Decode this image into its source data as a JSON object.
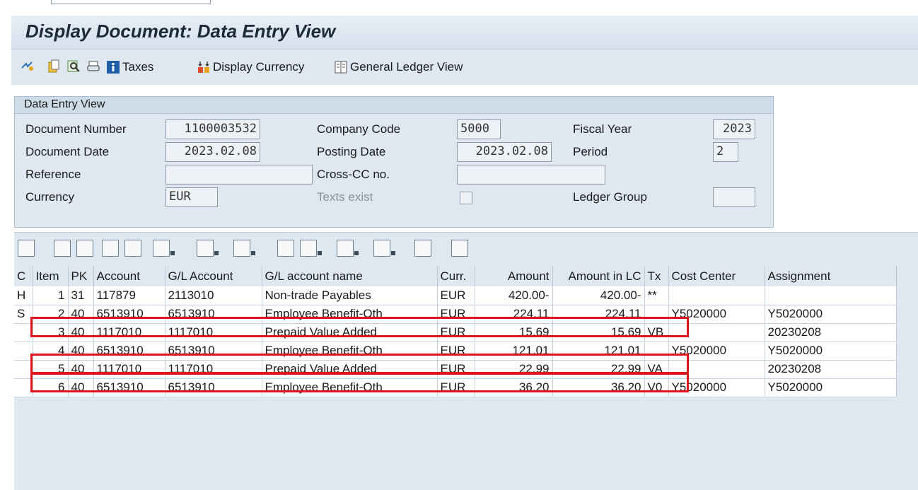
{
  "title": "Display Document: Data Entry View",
  "toolbar": {
    "icons": [
      "display-other-icon",
      "document-icon",
      "search-icon",
      "print-icon",
      "info-icon"
    ],
    "taxes_label": "Taxes",
    "display_currency_label": "Display Currency",
    "general_ledger_view_label": "General Ledger View"
  },
  "group": {
    "title": "Data Entry View",
    "document_number_label": "Document Number",
    "document_number": "1100003532",
    "company_code_label": "Company Code",
    "company_code": "5000",
    "fiscal_year_label": "Fiscal Year",
    "fiscal_year": "2023",
    "document_date_label": "Document Date",
    "document_date": "2023.02.08",
    "posting_date_label": "Posting Date",
    "posting_date": "2023.02.08",
    "period_label": "Period",
    "period": "2",
    "reference_label": "Reference",
    "reference": "",
    "cross_cc_label": "Cross-CC no.",
    "cross_cc": "",
    "currency_label": "Currency",
    "currency": "EUR",
    "texts_exist_label": "Texts exist",
    "ledger_group_label": "Ledger Group",
    "ledger_group": ""
  },
  "grid": {
    "columns": [
      "C",
      "Item",
      "PK",
      "Account",
      "G/L Account",
      "G/L account name",
      "Curr.",
      "Amount",
      "Amount in LC",
      "Tx",
      "Cost Center",
      "Assignment"
    ],
    "rows": [
      {
        "c": "H",
        "item": "1",
        "pk": "31",
        "account": "117879",
        "gl": "2113010",
        "name": "Non-trade Payables",
        "curr": "EUR",
        "amount": "420.00-",
        "amount_lc": "420.00-",
        "tx": "**",
        "cost_center": "",
        "assignment": ""
      },
      {
        "c": "S",
        "item": "2",
        "pk": "40",
        "account": "6513910",
        "gl": "6513910",
        "name": "Employee Benefit-Oth",
        "curr": "EUR",
        "amount": "224.11",
        "amount_lc": "224.11",
        "tx": "",
        "cost_center": "Y5020000",
        "assignment": "Y5020000"
      },
      {
        "c": "",
        "item": "3",
        "pk": "40",
        "account": "1117010",
        "gl": "1117010",
        "name": "Prepaid Value Added",
        "curr": "EUR",
        "amount": "15.69",
        "amount_lc": "15.69",
        "tx": "VB",
        "cost_center": "",
        "assignment": "20230208"
      },
      {
        "c": "",
        "item": "4",
        "pk": "40",
        "account": "6513910",
        "gl": "6513910",
        "name": "Employee Benefit-Oth",
        "curr": "EUR",
        "amount": "121.01",
        "amount_lc": "121.01",
        "tx": "",
        "cost_center": "Y5020000",
        "assignment": "Y5020000"
      },
      {
        "c": "",
        "item": "5",
        "pk": "40",
        "account": "1117010",
        "gl": "1117010",
        "name": "Prepaid Value Added",
        "curr": "EUR",
        "amount": "22.99",
        "amount_lc": "22.99",
        "tx": "VA",
        "cost_center": "",
        "assignment": "20230208"
      },
      {
        "c": "",
        "item": "6",
        "pk": "40",
        "account": "6513910",
        "gl": "6513910",
        "name": "Employee Benefit-Oth",
        "curr": "EUR",
        "amount": "36.20",
        "amount_lc": "36.20",
        "tx": "V0",
        "cost_center": "Y5020000",
        "assignment": "Y5020000"
      }
    ],
    "highlighted_items": [
      "3",
      "5",
      "6"
    ],
    "highlight_color": "#e0141c"
  },
  "colors": {
    "background": "#dfe8f1",
    "title_text": "#1d2a3a",
    "highlight": "#e0141c"
  }
}
